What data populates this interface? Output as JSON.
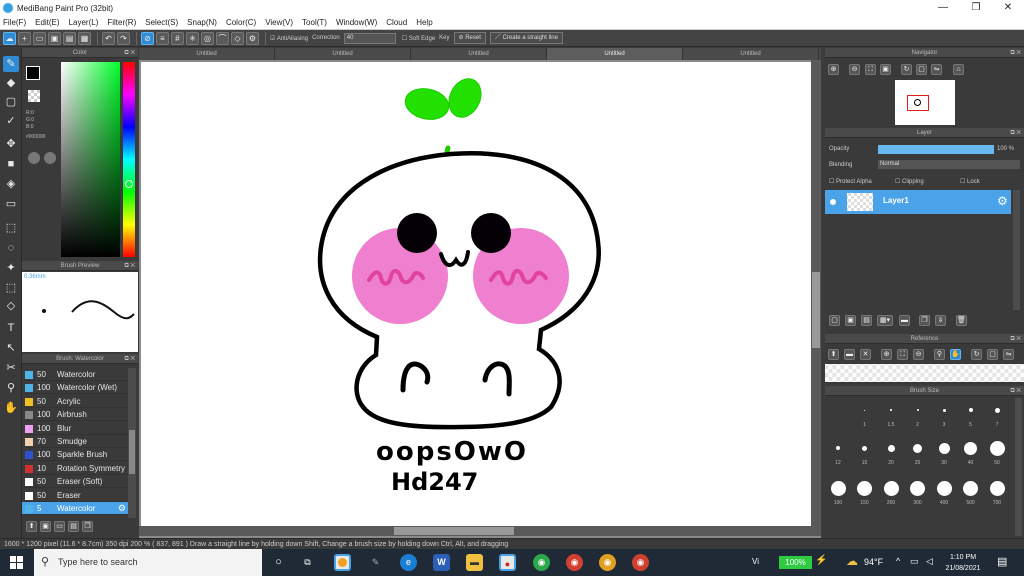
{
  "window": {
    "title": "MediBang Paint Pro (32bit)",
    "controls": [
      "—",
      "❐",
      "✕"
    ]
  },
  "menu": [
    "File(F)",
    "Edit(E)",
    "Layer(L)",
    "Filter(R)",
    "Select(S)",
    "Snap(N)",
    "Color(C)",
    "View(V)",
    "Tool(T)",
    "Window(W)",
    "Cloud",
    "Help"
  ],
  "toolbar": {
    "antialiasing_label": "AntiAliasing",
    "correction_label": "Correction",
    "correction_value": "40",
    "soft_edge_label": "Soft Edge",
    "key_label": "Key",
    "reset_label": "Reset",
    "straight_line_label": "Create a straight line"
  },
  "color_panel": {
    "title": "Color",
    "r": "R:0",
    "g": "G:0",
    "b": "B:0",
    "hex": "#000000",
    "main_color": "#000000",
    "sub_color": "#ffffff"
  },
  "brush_preview": {
    "title": "Brush Preview",
    "size_label": "0.36mm"
  },
  "brush_list": {
    "title": "Brush: Watercolor",
    "items": [
      {
        "size": "50",
        "name": "Watercolor",
        "color": "#4fb3e8"
      },
      {
        "size": "100",
        "name": "Watercolor (Wet)",
        "color": "#4fb3e8"
      },
      {
        "size": "50",
        "name": "Acrylic",
        "color": "#f0c020"
      },
      {
        "size": "100",
        "name": "Airbrush",
        "color": "#888888"
      },
      {
        "size": "100",
        "name": "Blur",
        "color": "#f0a0f0"
      },
      {
        "size": "70",
        "name": "Smudge",
        "color": "#f0d0b0"
      },
      {
        "size": "100",
        "name": "Sparkle Brush",
        "color": "#3050d0"
      },
      {
        "size": "10",
        "name": "Rotation Symmetry",
        "color": "#d03030"
      },
      {
        "size": "50",
        "name": "Eraser (Soft)",
        "color": "#ffffff"
      },
      {
        "size": "50",
        "name": "Eraser",
        "color": "#ffffff"
      },
      {
        "size": "5",
        "name": "Watercolor",
        "color": "#4fb3e8"
      }
    ]
  },
  "tabs": [
    "Untitled",
    "Untitled",
    "Untitled",
    "Untitled",
    "Untitled"
  ],
  "canvas": {
    "text_line1": "oopsOwO",
    "text_line2": "Hd247",
    "leaf_color": "#22e000",
    "blush_color": "#ef7fcf",
    "blush_mark_color": "#e0449e"
  },
  "navigator": {
    "title": "Navigator"
  },
  "layer_panel": {
    "title": "Layer",
    "opacity_label": "Opacity",
    "opacity_value": "100 %",
    "opacity_level": 1.0,
    "blending_label": "Blending",
    "blending_value": "Normal",
    "protect_alpha_label": "Protect Alpha",
    "clipping_label": "Clipping",
    "lock_label": "Lock",
    "layer_name": "Layer1"
  },
  "reference": {
    "title": "Reference"
  },
  "brush_size": {
    "title": "Brush Size",
    "row1": [
      "1",
      "1.5",
      "2",
      "3",
      "5",
      "7"
    ],
    "row2": [
      "12",
      "15",
      "20",
      "25",
      "30",
      "40",
      "50"
    ],
    "row3": [
      "100",
      "150",
      "200",
      "300",
      "400",
      "500",
      "700"
    ]
  },
  "status": {
    "text": "1600 * 1200 pixel   (11.6 * 8.7cm)   350 dpi   200 %   ( 837, 891 )   Draw a straight line by holding down Shift, Change a brush size by holding down Ctrl, Alt, and dragging"
  },
  "taskbar": {
    "search_placeholder": "Type here to search",
    "battery": "100%",
    "temperature": "94°F",
    "time": "1:10 PM",
    "date": "21/08/2021",
    "vi_label": "Vi"
  }
}
